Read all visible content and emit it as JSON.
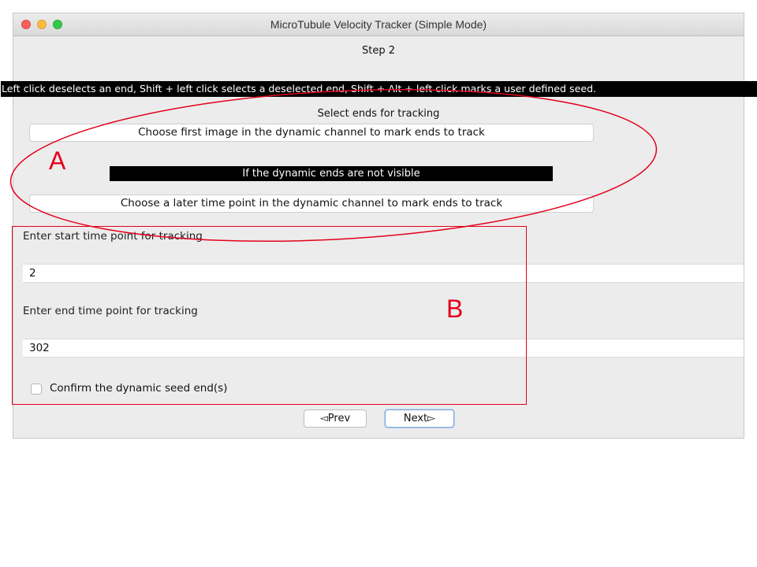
{
  "window": {
    "title": "MicroTubule Velocity Tracker (Simple Mode)"
  },
  "step_label": "Step 2",
  "instruction": "Left click deselects an end, Shift + left click selects a deselected end, Shift + Alt + left click marks a user defined seed.",
  "select_ends_label": "Select ends for tracking",
  "buttons": {
    "first_image": "Choose first image in the dynamic channel to mark ends to track",
    "later_time": "Choose a later time point in the dynamic channel to mark ends to track",
    "prev": "◅Prev",
    "next": "Next▻"
  },
  "not_visible_note": "If the dynamic ends are not visible",
  "start": {
    "label": "Enter start time point for tracking",
    "value": "2"
  },
  "end": {
    "label": "Enter end time point for tracking",
    "value": "302"
  },
  "confirm_checkbox": {
    "label": "Confirm the dynamic seed end(s)",
    "checked": false
  },
  "annotations": {
    "a": "A",
    "b": "B",
    "color": "#e3001b"
  },
  "colors": {
    "window_bg": "#ececec",
    "banner_bg": "#000000",
    "close": "#fc605c",
    "minimize": "#fdbc40",
    "maximize": "#34c84a"
  }
}
